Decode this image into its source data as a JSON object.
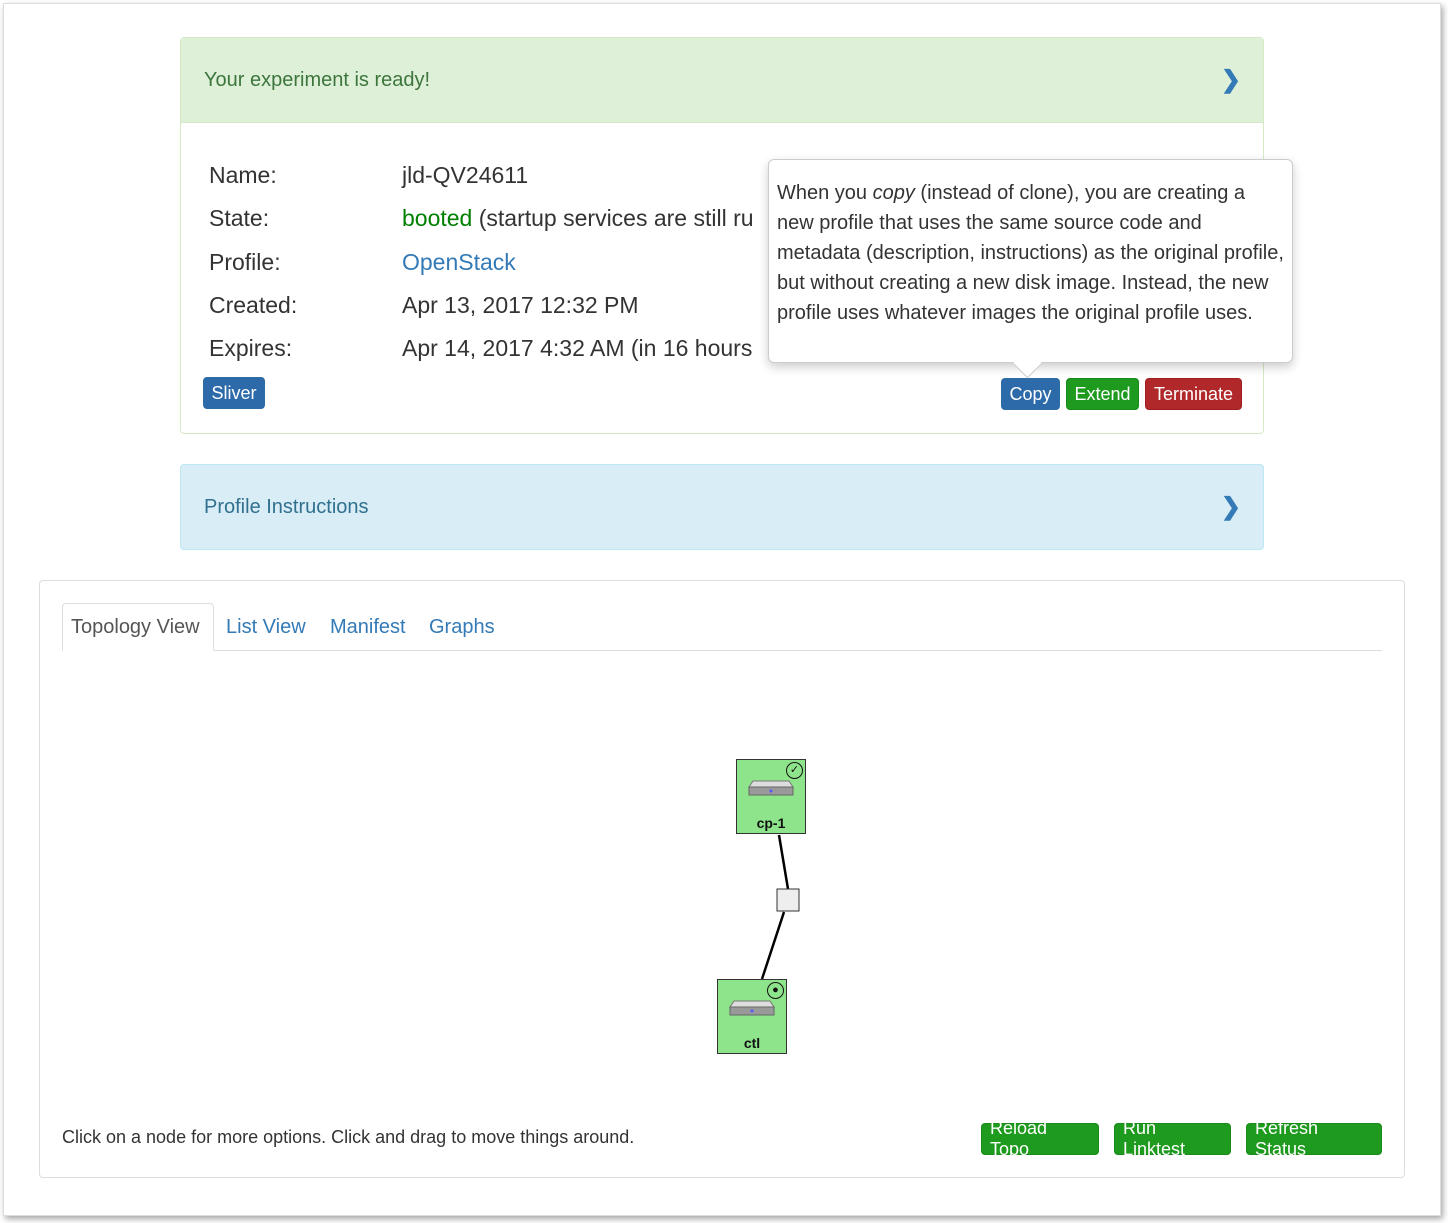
{
  "status_panel": {
    "title": "Your experiment is ready!",
    "chevron": "chevron-right-icon",
    "rows": [
      {
        "label": "Name:",
        "value": "jld-QV24611"
      },
      {
        "label": "State:",
        "value_status": "booted",
        "value": " (startup services are still ru"
      },
      {
        "label": "Profile:",
        "value": "OpenStack"
      },
      {
        "label": "Created:",
        "value": "Apr 13, 2017 12:32 PM"
      },
      {
        "label": "Expires:",
        "value": "Apr 14, 2017 4:32 AM (in 16 hours"
      }
    ],
    "buttons": {
      "sliver": "Sliver",
      "copy": "Copy",
      "extend": "Extend",
      "terminate": "Terminate"
    }
  },
  "tooltip": {
    "before": "When you ",
    "em": "copy",
    "after": " (instead of clone), you are creating a new profile that uses the same source code and metadata (description, instructions) as the original profile, but without creating a new disk image. Instead, the new profile uses whatever images the original profile uses."
  },
  "instructions_panel": {
    "title": "Profile Instructions"
  },
  "topology": {
    "tabs": [
      "Topology View",
      "List View",
      "Manifest",
      "Graphs"
    ],
    "nodes": [
      {
        "name": "cp-1",
        "status": "ready-check-icon"
      },
      {
        "name": "ctl",
        "status": "startup-dot-icon"
      }
    ],
    "help": "Click on a node for more options. Click and drag to move things around.",
    "buttons": {
      "reload": "Reload Topo",
      "linktest": "Run Linktest",
      "refresh": "Refresh Status"
    }
  },
  "colors": {
    "success_bg": "#dff0d8",
    "info_bg": "#d9edf7",
    "node_green": "#8ee48a",
    "btn_green": "#1e9a1e",
    "btn_red": "#b0282a",
    "btn_blue": "#2d6aa9",
    "link": "#337ab7",
    "booted": "#008000"
  }
}
